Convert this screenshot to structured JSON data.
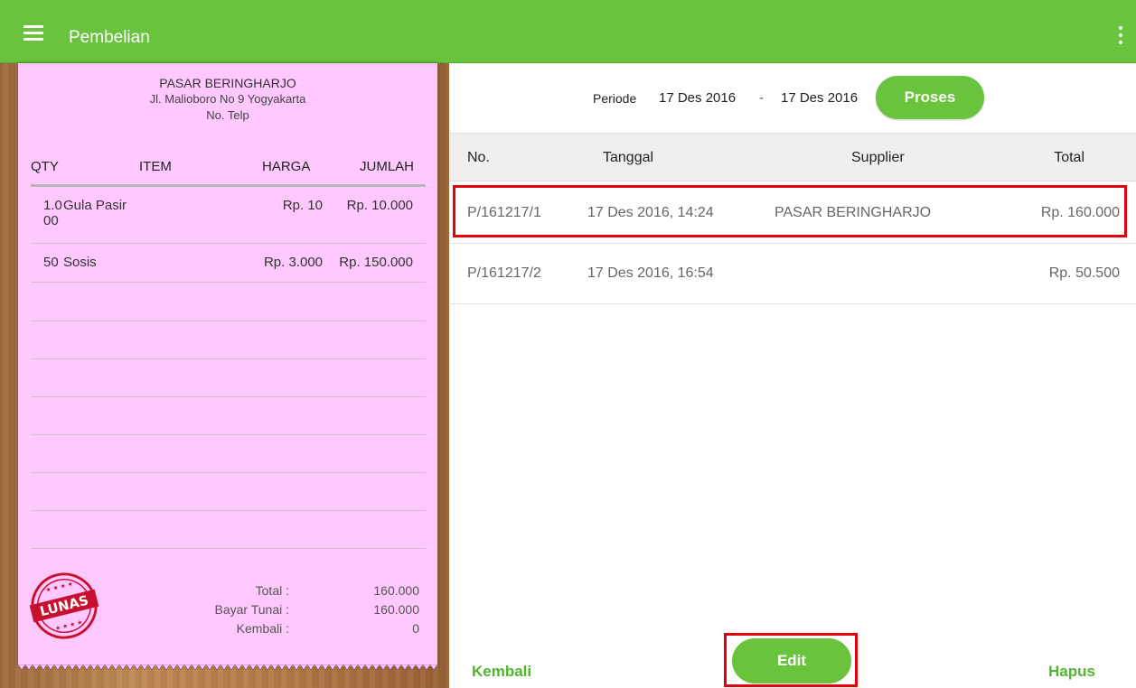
{
  "appbar": {
    "title": "Pembelian",
    "bg_color": "#6ac33c",
    "menu_icon": "hamburger-menu-icon",
    "overflow_icon": "more-vert-icon"
  },
  "receipt": {
    "store_name": "PASAR BERINGHARJO",
    "address": "Jl. Malioboro No 9 Yogyakarta",
    "phone_label": "No. Telp",
    "columns": {
      "qty": "QTY",
      "item": "ITEM",
      "harga": "HARGA",
      "jumlah": "JUMLAH"
    },
    "items": [
      {
        "qty_line1": "1.0",
        "qty_line2": "00",
        "item": "Gula Pasir",
        "harga": "Rp. 10",
        "jumlah": "Rp. 10.000"
      },
      {
        "qty_line1": "50",
        "qty_line2": "",
        "item": "Sosis",
        "harga": "Rp. 3.000",
        "jumlah": "Rp. 150.000"
      }
    ],
    "stamp_text": "LUNAS",
    "totals": {
      "total_label": "Total :",
      "total_value": "160.000",
      "bayar_label": "Bayar Tunai :",
      "bayar_value": "160.000",
      "kembali_label": "Kembali :",
      "kembali_value": "0"
    },
    "paper_color": "#ffc8fe"
  },
  "filter": {
    "period_label": "Periode",
    "date_from": "17 Des 2016",
    "separator": "-",
    "date_to": "17 Des 2016",
    "process_button": "Proses"
  },
  "table": {
    "headers": {
      "no": "No.",
      "tanggal": "Tanggal",
      "supplier": "Supplier",
      "total": "Total"
    },
    "rows": [
      {
        "no": "P/161217/1",
        "tanggal": "17 Des 2016, 14:24",
        "supplier": "PASAR BERINGHARJO",
        "total": "Rp. 160.000",
        "selected": true
      },
      {
        "no": "P/161217/2",
        "tanggal": "17 Des 2016, 16:54",
        "supplier": "",
        "total": "Rp. 50.500",
        "selected": false
      }
    ]
  },
  "actions": {
    "back": "Kembali",
    "edit": "Edit",
    "delete": "Hapus"
  },
  "highlight_color": "#e5000e"
}
